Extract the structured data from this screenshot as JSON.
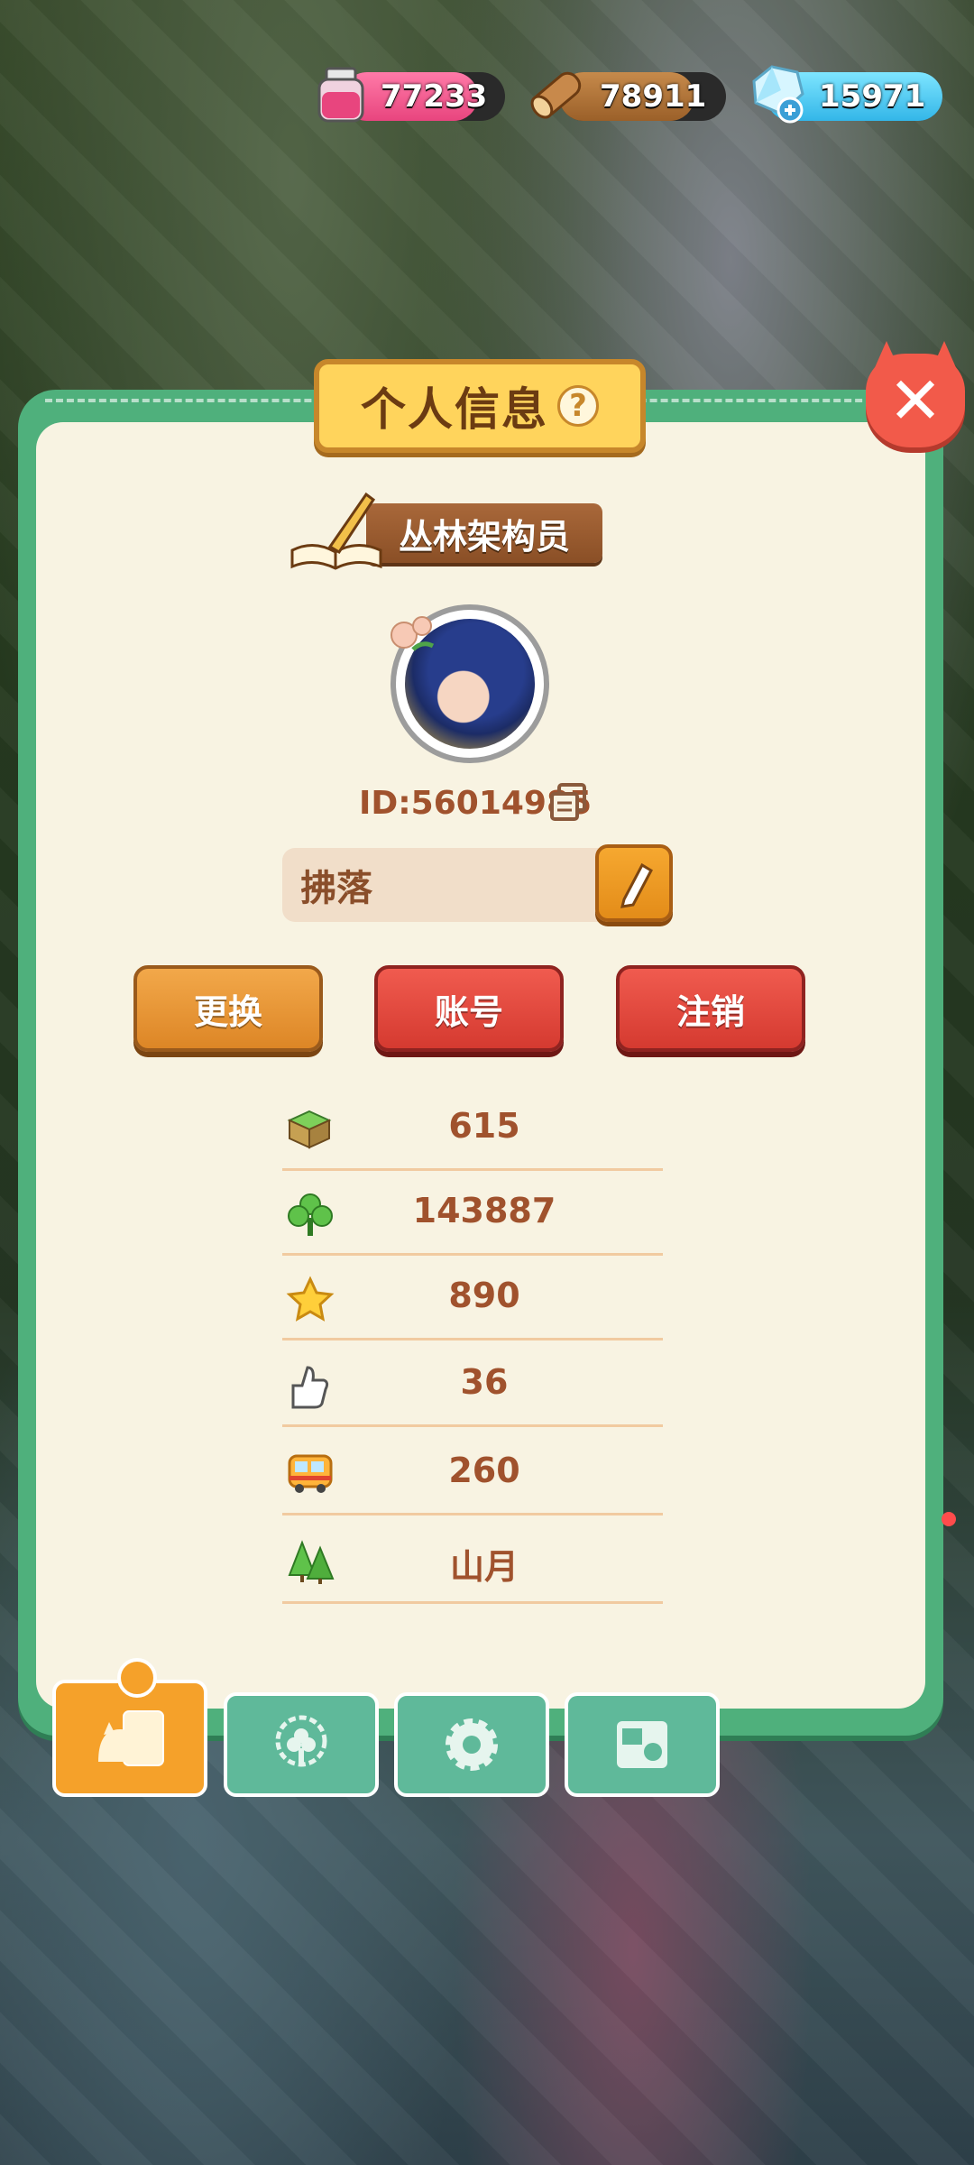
{
  "resources": {
    "ink": "77233",
    "wood": "78911",
    "gem": "15971"
  },
  "panel": {
    "title": "个人信息",
    "help": "?",
    "rank_title": "丛林架构员",
    "user_id": "ID:56014985",
    "nickname": "拂落"
  },
  "buttons": {
    "change": "更换",
    "account": "账号",
    "logout": "注销"
  },
  "stats": [
    {
      "icon": "grass-block-icon",
      "value": "615"
    },
    {
      "icon": "clover-icon",
      "value": "143887"
    },
    {
      "icon": "star-icon",
      "value": "890"
    },
    {
      "icon": "thumbs-up-icon",
      "value": "36"
    },
    {
      "icon": "bus-icon",
      "value": "260"
    },
    {
      "icon": "trees-icon",
      "value": "山月"
    }
  ],
  "tabs": [
    {
      "name": "profile-tab",
      "icon": "profile-card-icon",
      "active": true
    },
    {
      "name": "badge-tab",
      "icon": "flower-badge-icon",
      "active": false
    },
    {
      "name": "settings-tab",
      "icon": "gear-icon",
      "active": false
    },
    {
      "name": "album-tab",
      "icon": "photo-album-icon",
      "active": false
    }
  ],
  "colors": {
    "panel_green": "#4fb07c",
    "panel_cream": "#f8f3e2",
    "text_brown": "#a0522d",
    "button_orange": "#e38c19",
    "button_red": "#d53a30"
  }
}
